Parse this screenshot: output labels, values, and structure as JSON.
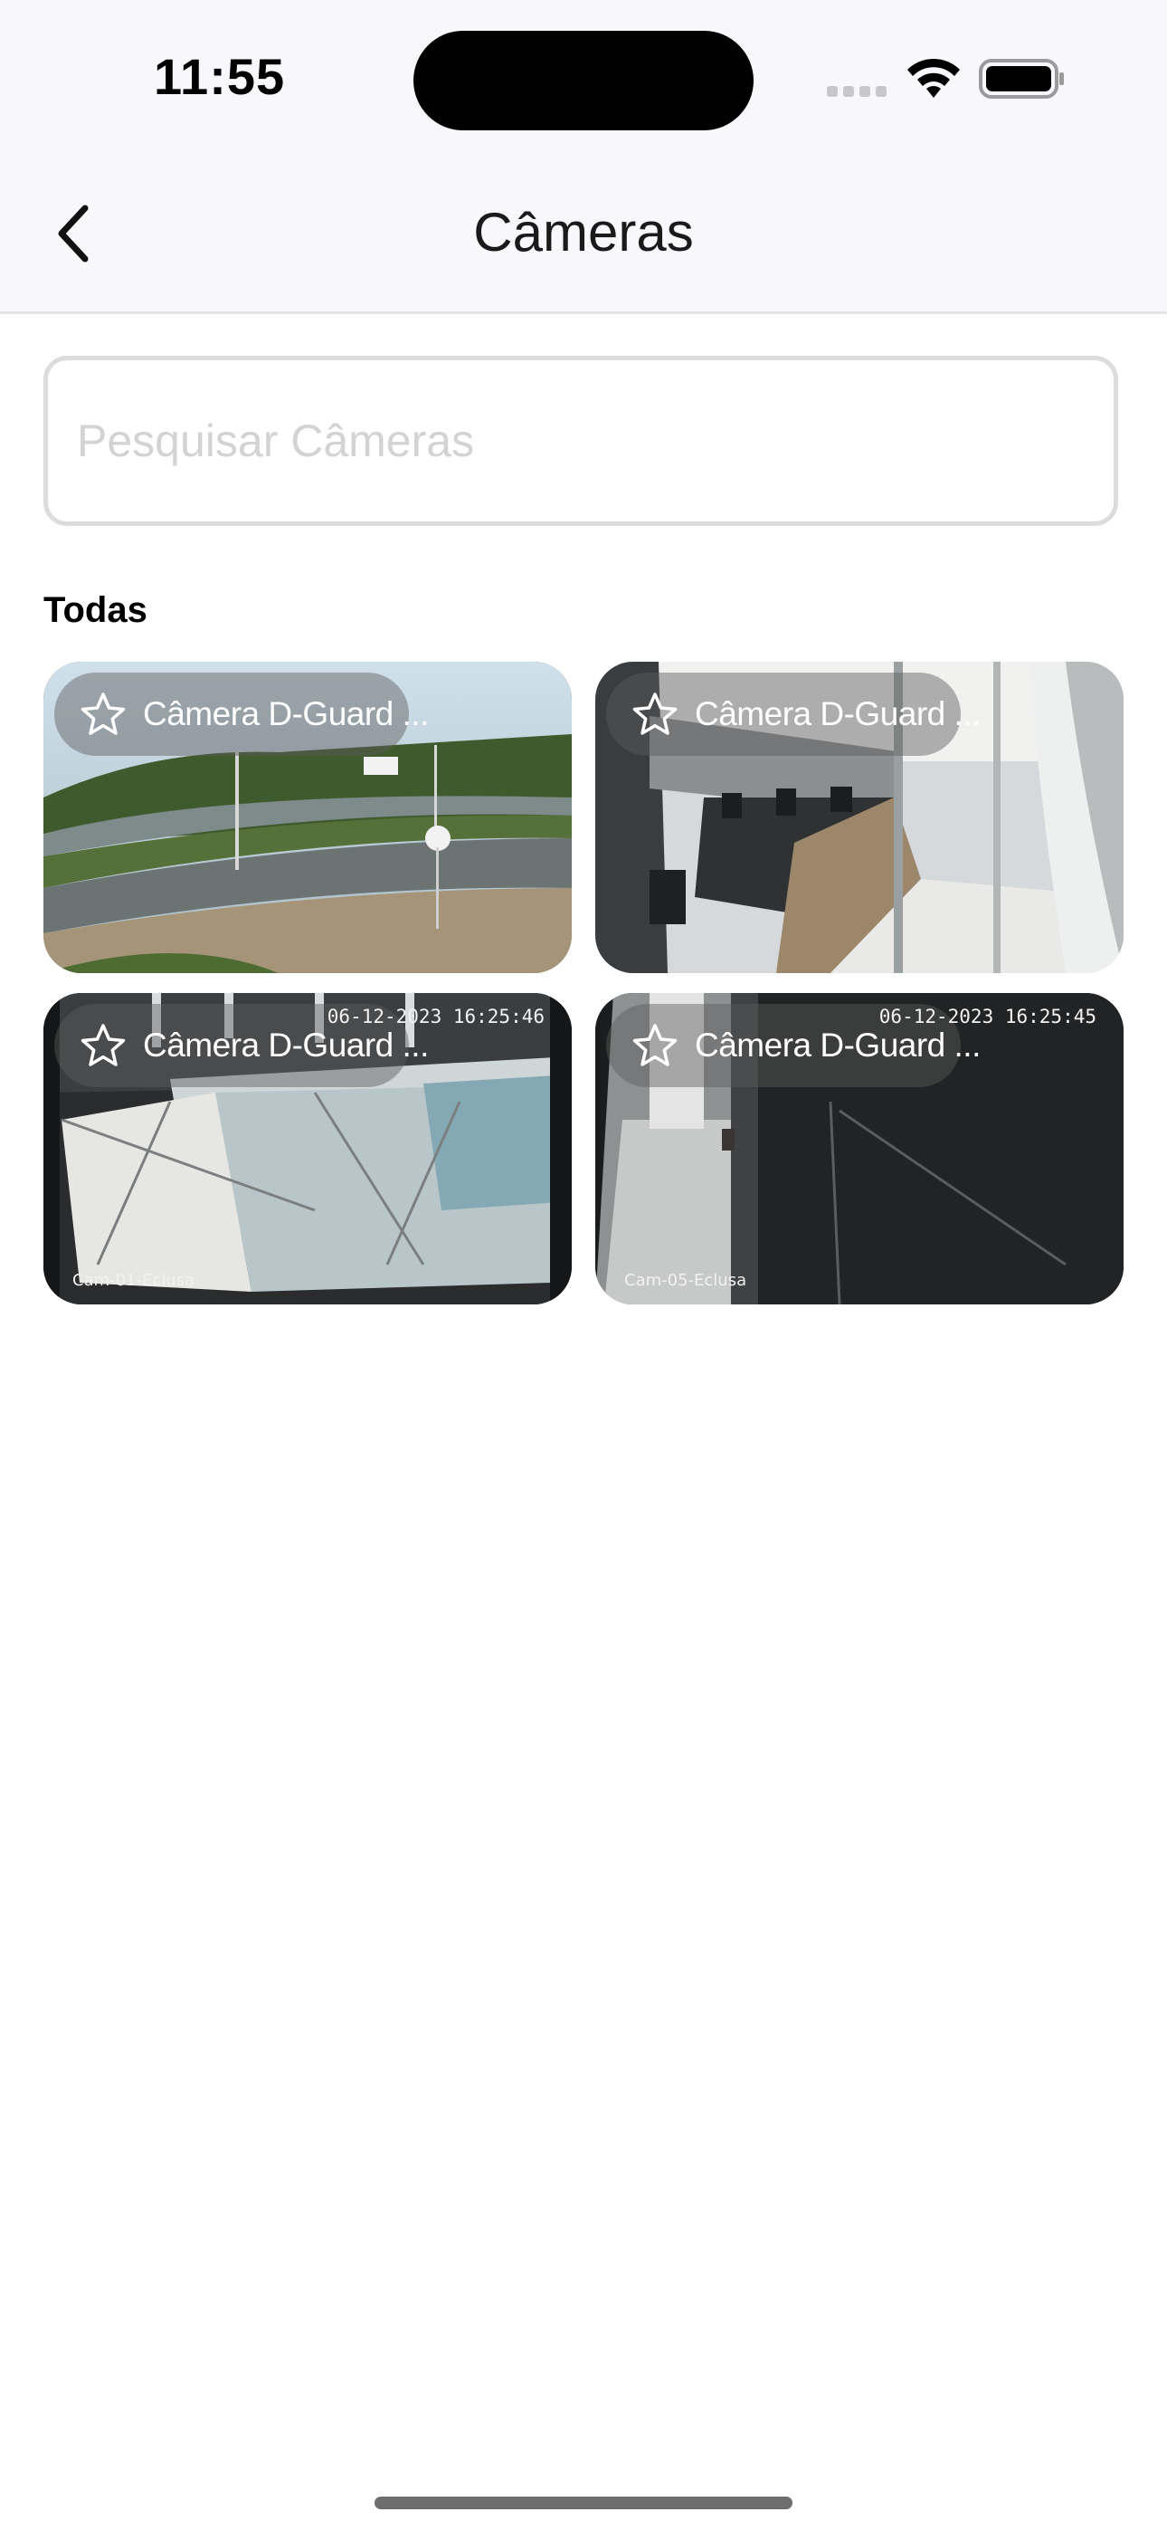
{
  "status_bar": {
    "time": "11:55",
    "icons": [
      "signal-icon",
      "wifi-icon",
      "battery-icon"
    ]
  },
  "nav": {
    "title": "Câmeras",
    "back_icon": "chevron-left-icon"
  },
  "search": {
    "placeholder": "Pesquisar Câmeras",
    "value": ""
  },
  "section": {
    "label": "Todas"
  },
  "cameras": [
    {
      "name": "Câmera D-Guard ...",
      "timestamp": "",
      "cam_id": "",
      "favorite": false,
      "icon": "star-icon"
    },
    {
      "name": "Câmera D-Guard ...",
      "timestamp": "",
      "cam_id": "",
      "favorite": false,
      "icon": "star-icon"
    },
    {
      "name": "Câmera D-Guard ...",
      "timestamp": "06-12-2023 16:25:46",
      "cam_id": "Cam-01-Eclusa",
      "favorite": false,
      "icon": "star-icon"
    },
    {
      "name": "Câmera D-Guard ...",
      "timestamp": "06-12-2023 16:25:45",
      "cam_id": "Cam-05-Eclusa",
      "favorite": false,
      "icon": "star-icon"
    }
  ],
  "colors": {
    "header_bg": "#f8f7fb",
    "search_border": "#dcdcdc",
    "placeholder": "#d3d3d3"
  }
}
